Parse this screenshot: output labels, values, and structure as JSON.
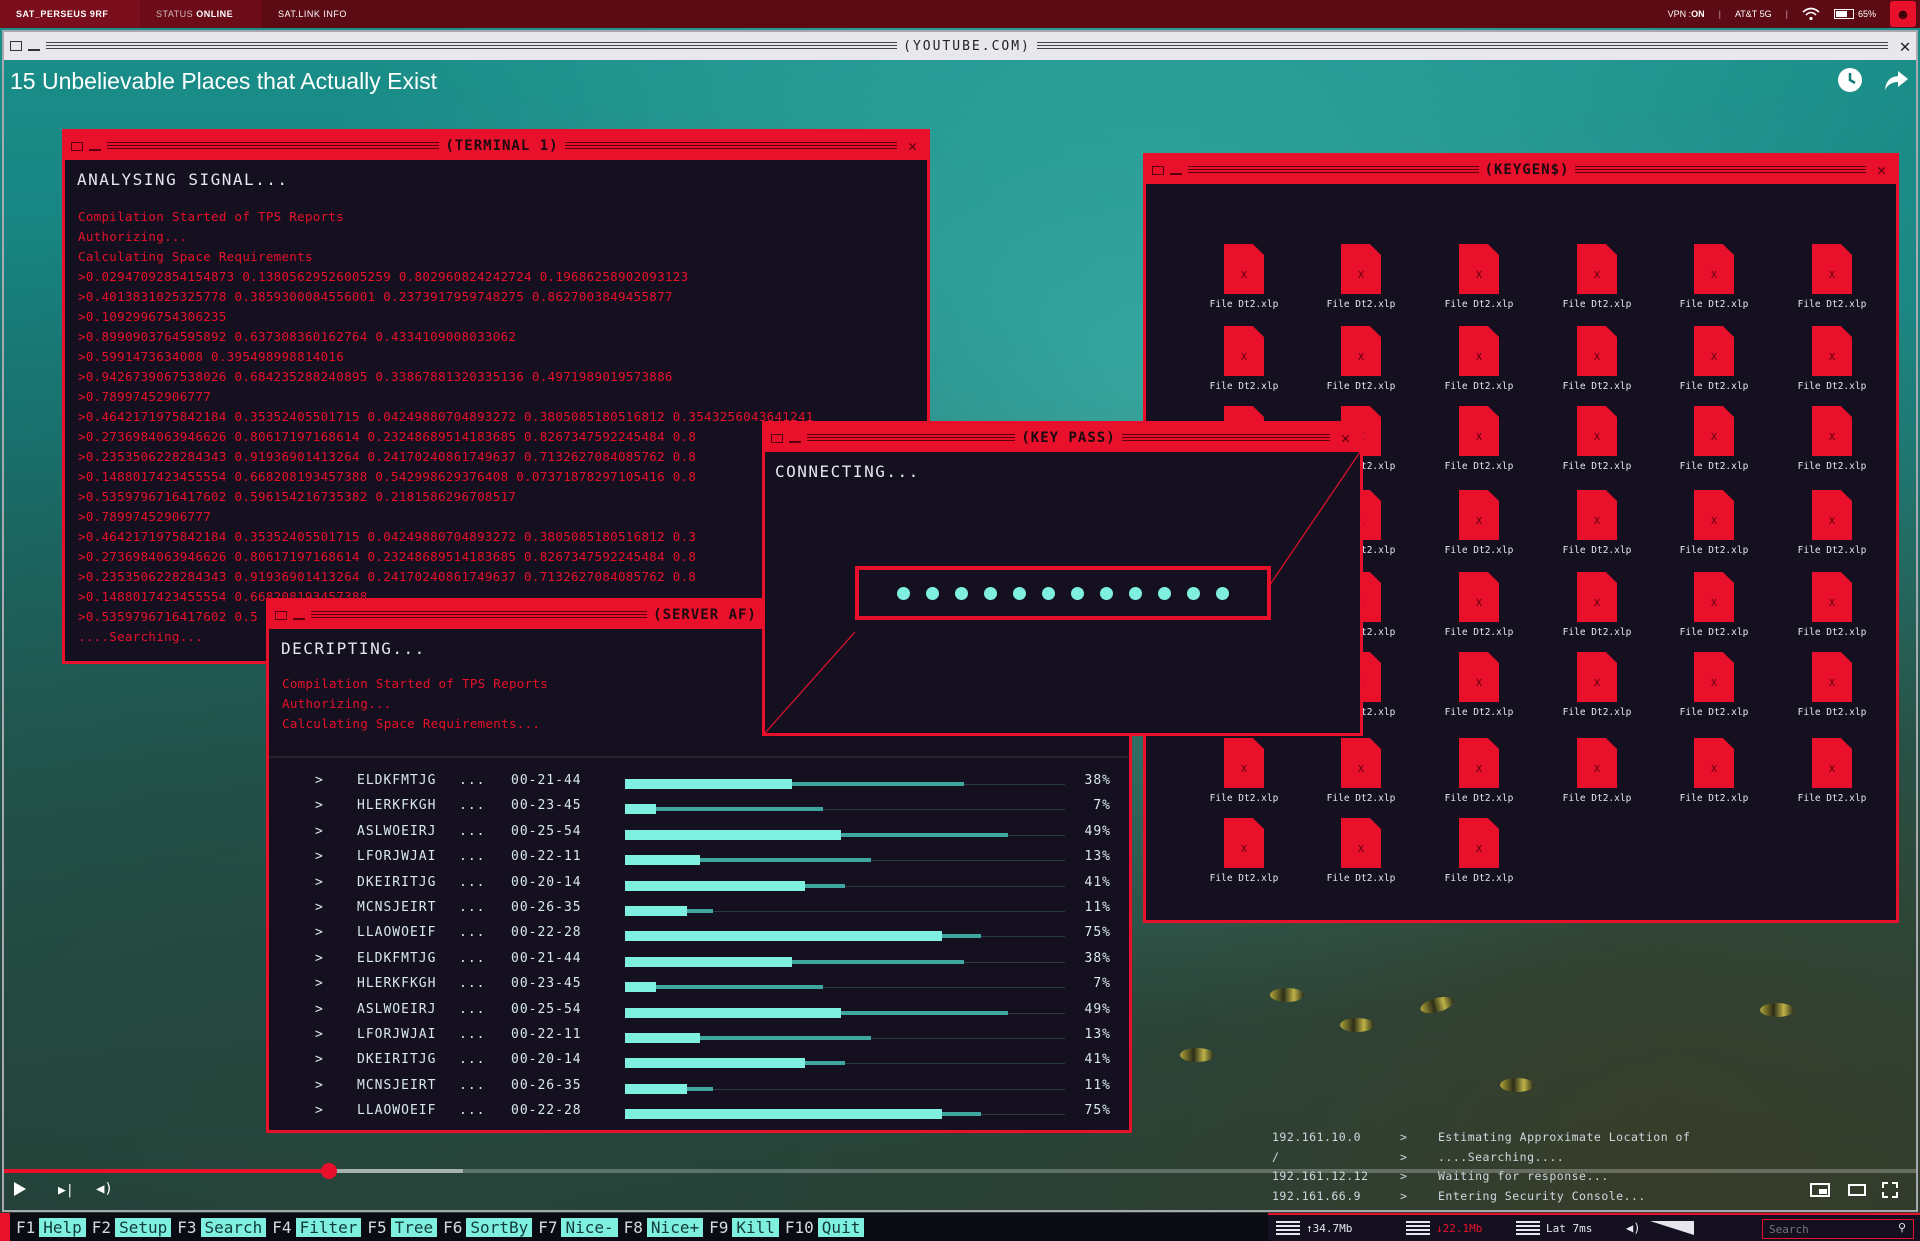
{
  "topbar": {
    "station": "SAT_PERSEUS 9RF",
    "status_label": "STATUS",
    "status_value": "ONLINE",
    "satlink": "SAT.LINK INFO",
    "vpn_label": "VPN :",
    "vpn_value": "ON",
    "carrier": "AT&T  5G",
    "battery": "65%"
  },
  "browser": {
    "url": "(YOUTUBE.COM)",
    "video_title": "15 Unbelievable Places that Actually Exist"
  },
  "terminal": {
    "title": "(TERMINAL 1)",
    "heading": "ANALYSING SIGNAL...",
    "lines": [
      "Compilation Started of TPS Reports",
      "Authorizing...",
      "Calculating Space Requirements",
      ">0.02947092854154873 0.13805629526005259 0.802960824242724 0.19686258902093123",
      ">0.4013831025325778 0.3859300084556001 0.2373917959748275 0.8627003849455877",
      ">0.1092996754306235",
      ">0.8990903764595892 0.637308360162764 0.4334109008033062",
      ">0.5991473634008 0.395498998814016",
      ">0.9426739067538026 0.684235288240895 0.33867881320335136 0.4971989019573886",
      ">0.78997452906777",
      ">0.4642171975842184 0.35352405501715 0.04249880704893272 0.3805085180516812 0.3543256043641241",
      ">0.2736984063946626 0.80617197168614 0.23248689514183685 0.8267347592245484 0.8",
      ">0.2353506228284343 0.91936901413264 0.24170240861749637 0.7132627084085762 0.8",
      ">0.1488017423455554 0.668208193457388 0.542998629376408 0.07371878297105416 0.8",
      ">0.5359796716417602 0.596154216735382 0.2181586296708517",
      ">0.78997452906777",
      ">0.4642171975842184 0.35352405501715 0.04249880704893272 0.3805085180516812 0.3",
      ">0.2736984063946626 0.80617197168614 0.23248689514183685 0.8267347592245484 0.8",
      ">0.2353506228284343 0.91936901413264 0.24170240861749637 0.7132627084085762 0.8",
      ">0.1488017423455554 0.668208193457388",
      ">0.5359796716417602 0.5",
      "....Searching..."
    ]
  },
  "keygen": {
    "title": "(KEYGEN$)",
    "file_label": "File Dt2.xlp",
    "file_glyph": "X"
  },
  "keypass": {
    "title": "(KEY PASS)",
    "heading": "CONNECTING..."
  },
  "server": {
    "title": "(SERVER AF)",
    "heading": "DECRIPTING...",
    "lines": [
      "Compilation Started of TPS Reports",
      "Authorizing...",
      "Calculating Space Requirements..."
    ],
    "rows": [
      {
        "name": "ELDKFMTJG",
        "dots": "...",
        "code": "00-21-44",
        "pct": "38%",
        "fill": 0.38,
        "bg": 0.77
      },
      {
        "name": "HLERKFKGH",
        "dots": "...",
        "code": "00-23-45",
        "pct": "7%",
        "fill": 0.07,
        "bg": 0.45
      },
      {
        "name": "ASLWOEIRJ",
        "dots": "...",
        "code": "00-25-54",
        "pct": "49%",
        "fill": 0.49,
        "bg": 0.87
      },
      {
        "name": "LFORJWJAI",
        "dots": "...",
        "code": "00-22-11",
        "pct": "13%",
        "fill": 0.17,
        "bg": 0.56
      },
      {
        "name": "DKEIRITJG",
        "dots": "...",
        "code": "00-20-14",
        "pct": "41%",
        "fill": 0.41,
        "bg": 0.5
      },
      {
        "name": "MCNSJEIRT",
        "dots": "...",
        "code": "00-26-35",
        "pct": "11%",
        "fill": 0.14,
        "bg": 0.2
      },
      {
        "name": "LLAOWOEIF",
        "dots": "...",
        "code": "00-22-28",
        "pct": "75%",
        "fill": 0.72,
        "bg": 0.81
      },
      {
        "name": "ELDKFMTJG",
        "dots": "...",
        "code": "00-21-44",
        "pct": "38%",
        "fill": 0.38,
        "bg": 0.77
      },
      {
        "name": "HLERKFKGH",
        "dots": "...",
        "code": "00-23-45",
        "pct": "7%",
        "fill": 0.07,
        "bg": 0.45
      },
      {
        "name": "ASLWOEIRJ",
        "dots": "...",
        "code": "00-25-54",
        "pct": "49%",
        "fill": 0.49,
        "bg": 0.87
      },
      {
        "name": "LFORJWJAI",
        "dots": "...",
        "code": "00-22-11",
        "pct": "13%",
        "fill": 0.17,
        "bg": 0.56
      },
      {
        "name": "DKEIRITJG",
        "dots": "...",
        "code": "00-20-14",
        "pct": "41%",
        "fill": 0.41,
        "bg": 0.5
      },
      {
        "name": "MCNSJEIRT",
        "dots": "...",
        "code": "00-26-35",
        "pct": "11%",
        "fill": 0.14,
        "bg": 0.2
      },
      {
        "name": "LLAOWOEIF",
        "dots": "...",
        "code": "00-22-28",
        "pct": "75%",
        "fill": 0.72,
        "bg": 0.81
      }
    ]
  },
  "log": [
    {
      "ip": "192.161.10.0",
      "msg": "Estimating Approximate Location of"
    },
    {
      "ip": "/",
      "msg": "....Searching...."
    },
    {
      "ip": "192.161.12.12",
      "msg": "Waiting for response..."
    },
    {
      "ip": "192.161.66.9",
      "msg": "Entering Security Console..."
    }
  ],
  "player": {
    "progress": 0.17
  },
  "fkeys": [
    {
      "key": "F1",
      "label": "Help"
    },
    {
      "key": "F2",
      "label": "Setup"
    },
    {
      "key": "F3",
      "label": "Search"
    },
    {
      "key": "F4",
      "label": "Filter"
    },
    {
      "key": "F5",
      "label": "Tree"
    },
    {
      "key": "F6",
      "label": "SortBy"
    },
    {
      "key": "F7",
      "label": "Nice-"
    },
    {
      "key": "F8",
      "label": "Nice+"
    },
    {
      "key": "F9",
      "label": "Kill"
    },
    {
      "key": "F10",
      "label": "Quit"
    }
  ],
  "net": {
    "up": "↑34.7Mb",
    "down": "↓22.1Mb",
    "lat": "Lat 7ms",
    "search_placeholder": "Search"
  },
  "colors": {
    "accent": "#e8102a",
    "cyan": "#7ff0e0",
    "panel": "#151020"
  }
}
